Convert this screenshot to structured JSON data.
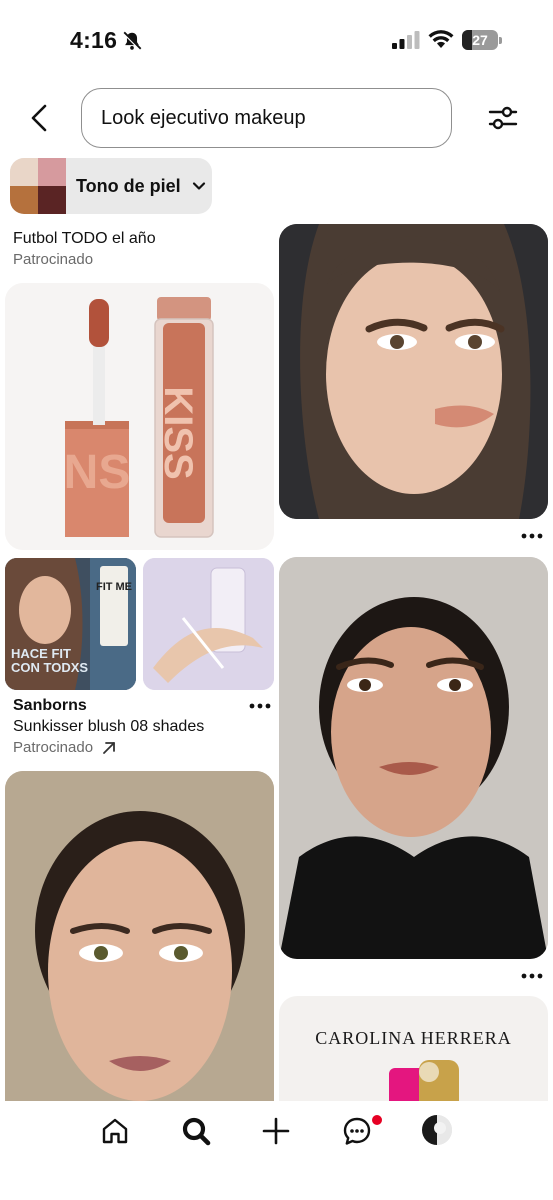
{
  "status_bar": {
    "time": "4:16",
    "battery_level": "27"
  },
  "search": {
    "query": "Look ejecutivo makeup"
  },
  "filter_chip": {
    "label": "Tono de piel",
    "swatch_colors": [
      "#e9d6c8",
      "#d69a9e",
      "#b5713d",
      "#5a2424"
    ]
  },
  "sponsored_1": {
    "title": "Futbol TODO el año",
    "label": "Patrocinado"
  },
  "sponsored_2": {
    "brand": "Sanborns",
    "title": "Sunkisser blush 08 shades",
    "label": "Patrocinado",
    "tile_a_text": [
      "HACE FIT",
      "CON TODXS"
    ],
    "tile_a_product": "FIT ME"
  },
  "carolina_ad": {
    "brand_text": "CAROLINA HERRERA"
  },
  "colors": {
    "accent": "#e60023",
    "text_secondary": "#6a6a6a"
  },
  "nav": {
    "items": [
      "home-icon",
      "search-icon",
      "create-icon",
      "messages-icon",
      "profile-avatar"
    ],
    "active": "search-icon",
    "has_notification": true
  }
}
